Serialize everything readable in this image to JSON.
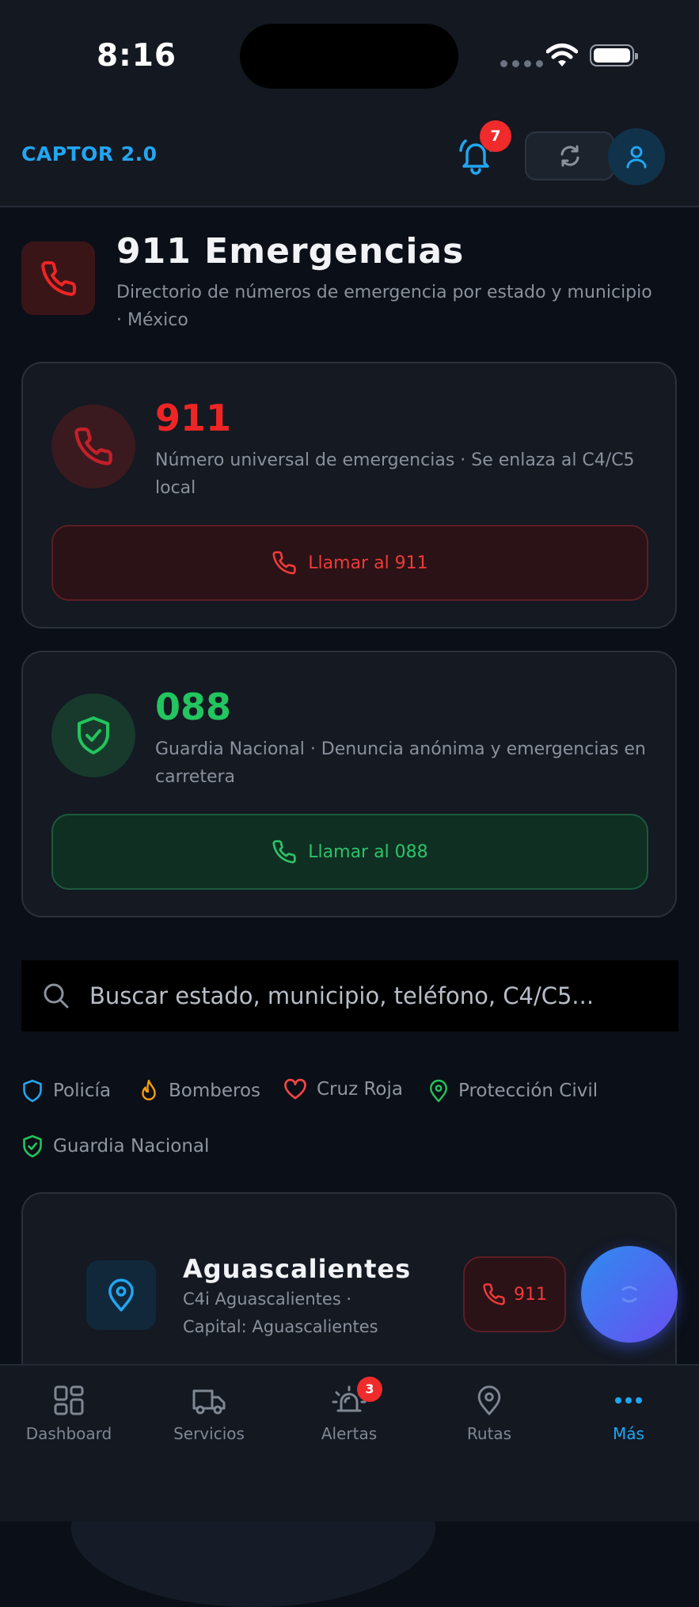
{
  "status_bar": {
    "time": "8:16"
  },
  "header": {
    "brand": "CAPTOR 2.0",
    "notification_count": "7"
  },
  "page": {
    "title": "911 Emergencias",
    "subtitle": "Directorio de números de emergencia por estado y municipio · México"
  },
  "emergency_cards": [
    {
      "number": "911",
      "description": "Número universal de emergencias · Se enlaza al C4/C5 local",
      "button_label": "Llamar al 911",
      "color": "#ef2525"
    },
    {
      "number": "088",
      "description": "Guardia Nacional · Denuncia anónima y emergencias en carretera",
      "button_label": "Llamar al 088",
      "color": "#22c55e"
    }
  ],
  "search": {
    "placeholder": "Buscar estado, municipio, teléfono, C4/C5..."
  },
  "filters": [
    {
      "label": "Policía",
      "icon": "shield-icon",
      "color": "#22a6f2"
    },
    {
      "label": "Bomberos",
      "icon": "flame-icon",
      "color": "#f59e0b"
    },
    {
      "label": "Cruz Roja",
      "icon": "heart-icon",
      "color": "#ef4444"
    },
    {
      "label": "Protección Civil",
      "icon": "map-pin-icon",
      "color": "#22c55e"
    },
    {
      "label": "Guardia Nacional",
      "icon": "shield-check-icon",
      "color": "#22c55e"
    }
  ],
  "states": [
    {
      "name": "Aguascalientes",
      "description": "C4i Aguascalientes · Capital: Aguascalientes",
      "call_label": "911"
    }
  ],
  "tab_bar": {
    "tabs": [
      {
        "label": "Dashboard",
        "icon": "grid-icon"
      },
      {
        "label": "Servicios",
        "icon": "truck-icon"
      },
      {
        "label": "Alertas",
        "icon": "siren-icon",
        "badge": "3"
      },
      {
        "label": "Rutas",
        "icon": "map-pin-icon"
      },
      {
        "label": "Más",
        "icon": "more-dots-icon",
        "active": true
      }
    ]
  }
}
